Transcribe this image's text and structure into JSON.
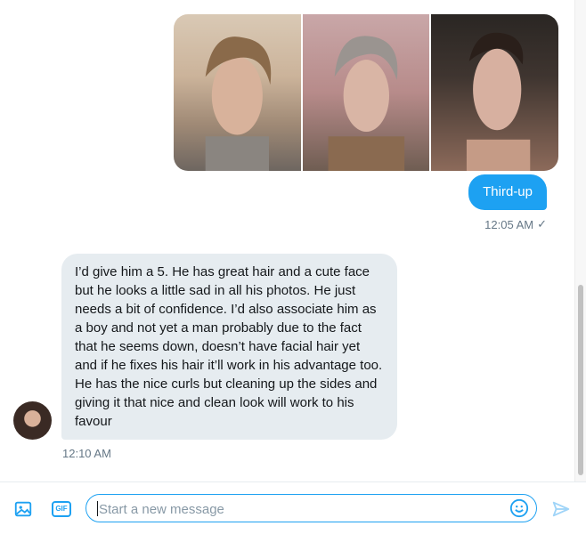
{
  "conversation": {
    "outgoing": {
      "images": [
        "photo-1",
        "photo-2",
        "photo-3"
      ],
      "text": "Third-up",
      "time": "12:05 AM",
      "status_icon": "check-icon"
    },
    "incoming": {
      "text": "I’d give him a 5. He has great hair and a cute face but he looks a little sad in all his photos. He just needs a bit of confidence. I’d also associate him as a boy and not yet a man probably due to the fact that he seems down, doesn’t have facial hair yet and if he fixes his hair it’ll work in his advantage too. He has the nice curls but cleaning up the sides and giving it that nice and clean look will work to his favour",
      "time": "12:10 AM"
    }
  },
  "composer": {
    "placeholder": "Start a new message",
    "value": "",
    "media_icon": "image-icon",
    "gif_label": "GIF",
    "emoji_icon": "emoji-icon",
    "send_icon": "send-icon"
  },
  "colors": {
    "accent": "#1da1f2",
    "incoming_bubble": "#e6ecf0",
    "meta_text": "#657786"
  }
}
